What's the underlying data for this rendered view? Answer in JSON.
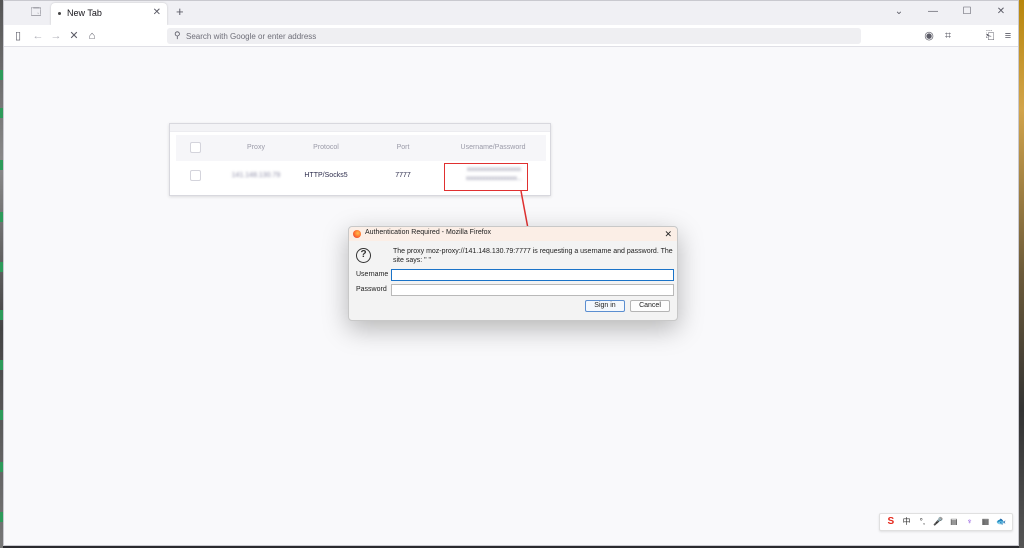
{
  "browser": {
    "tab": {
      "title": "New Tab",
      "close": "✕"
    },
    "new_tab": "+",
    "window_controls": {
      "list_all_tabs": "⌄",
      "minimize": "—",
      "maximize": "☐",
      "close": "✕"
    },
    "urlbar": {
      "value": "",
      "placeholder": "Search with Google or enter address"
    }
  },
  "proxy_table": {
    "headers": [
      "",
      "Proxy",
      "Protocol",
      "Port",
      "Username/Password"
    ],
    "row": {
      "proxy": "141.148.130.79",
      "protocol": "HTTP/Socks5",
      "port": "7777",
      "credentials_line1": "xxxxxxxxxxxxxxxxxx",
      "credentials_line2": "xxxxxxxxxxxxxxxxx..."
    }
  },
  "auth_dialog": {
    "title": "Authentication Required - Mozilla Firefox",
    "close": "✕",
    "help_symbol": "?",
    "message": "The proxy moz-proxy://141.148.130.79:7777 is requesting a username and password. The site says: \"   \"",
    "username_label": "Username",
    "password_label": "Password",
    "username_value": "",
    "password_value": "",
    "sign_in": "Sign in",
    "cancel": "Cancel"
  },
  "ime_tray": {
    "items": [
      "S",
      "中",
      "°,",
      "🎤",
      "▤",
      "♆",
      "▦",
      "🐟"
    ]
  },
  "colors": {
    "annotation_red": "#e03030",
    "focus_blue": "#1a73c8"
  }
}
